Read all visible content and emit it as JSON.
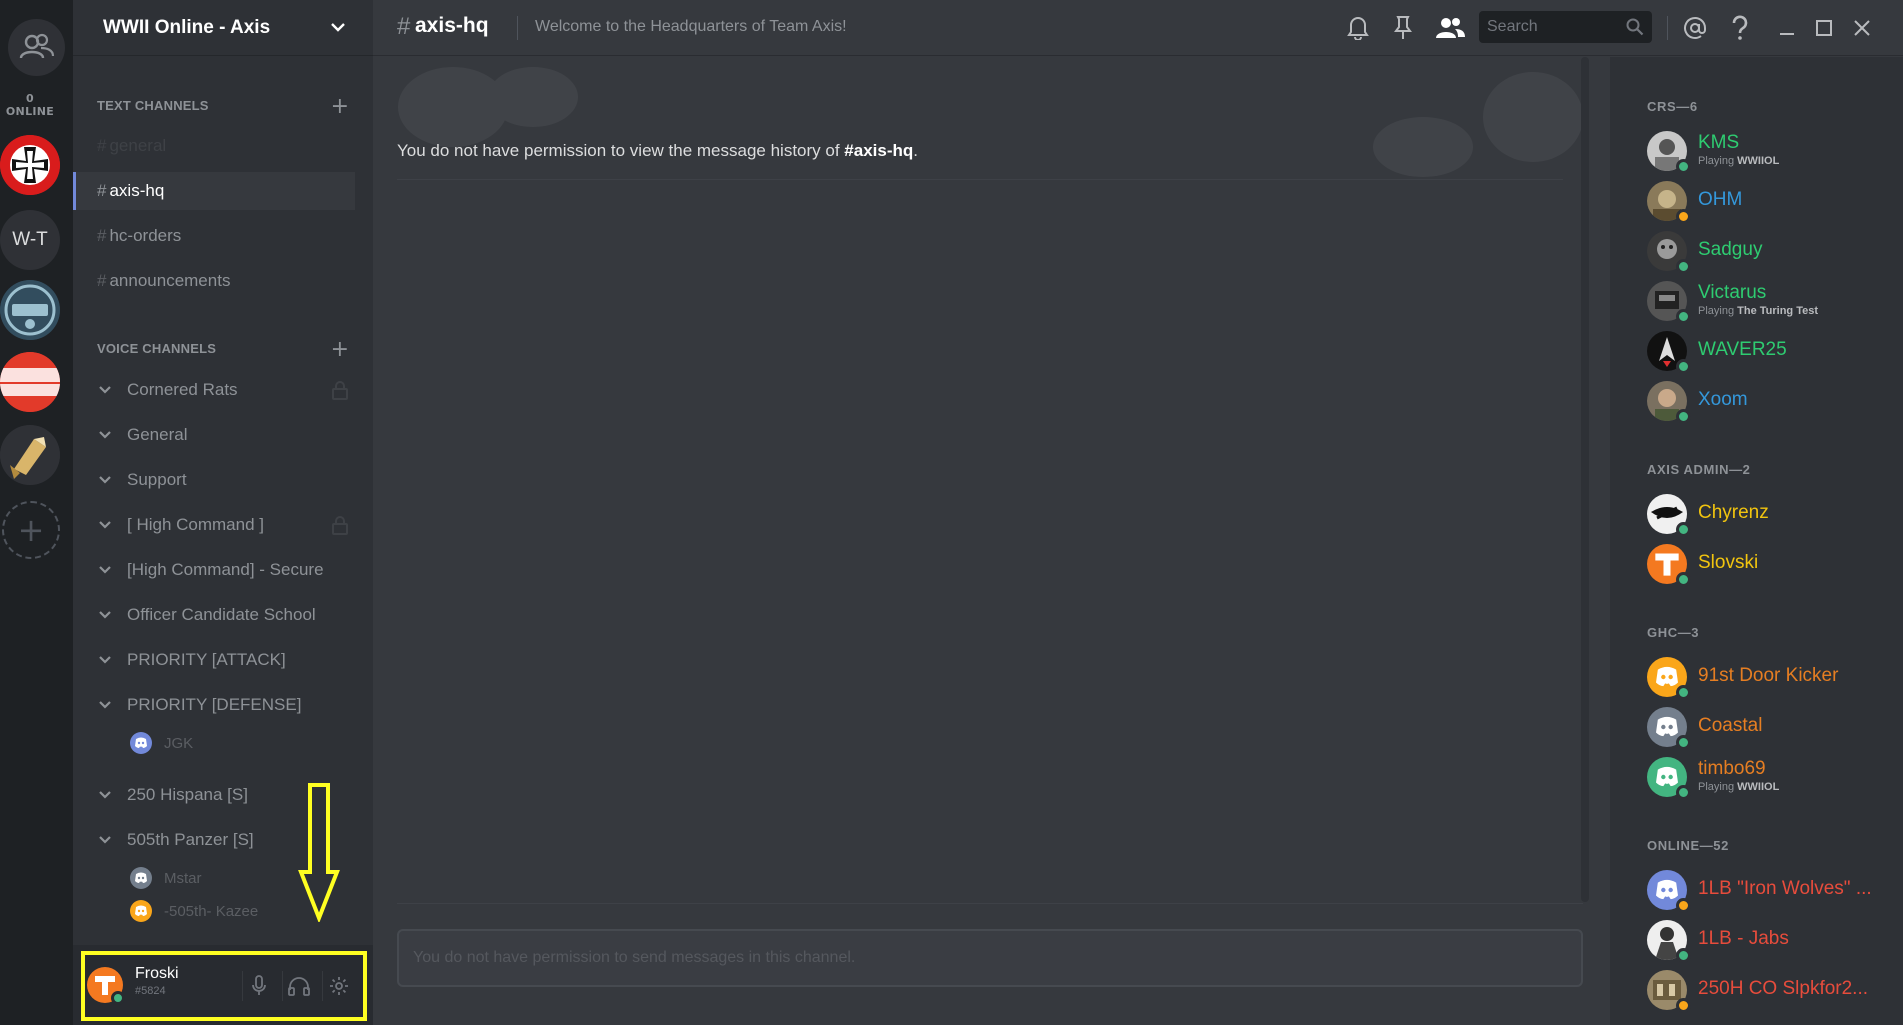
{
  "colors": {
    "accent": "#7289da",
    "online": "#43b581",
    "idle": "#faa61a",
    "highlight": "#ffff22",
    "role_crs": "#2ecc71",
    "role_blue": "#3498db",
    "role_admin": "#f1c40f",
    "role_ghc": "#e67e22",
    "role_online": "#e74c3c"
  },
  "guild_rail": {
    "online_count": "0 ONLINE",
    "guilds": [
      {
        "name": "iron-cross-server",
        "label": ""
      },
      {
        "name": "w-t-server",
        "label": "W-T"
      },
      {
        "name": "ard-server",
        "label": ""
      },
      {
        "name": "golden-corral-server",
        "label": ""
      },
      {
        "name": "rocket-server",
        "label": ""
      }
    ]
  },
  "server": {
    "name": "WWII Online - Axis"
  },
  "text_channels": {
    "header": "TEXT CHANNELS",
    "items": [
      {
        "name": "general"
      },
      {
        "name": "axis-hq"
      },
      {
        "name": "hc-orders"
      },
      {
        "name": "announcements"
      }
    ]
  },
  "voice_channels": {
    "header": "VOICE CHANNELS",
    "items": [
      {
        "name": "Cornered Rats"
      },
      {
        "name": "General"
      },
      {
        "name": "Support"
      },
      {
        "name": "[ High Command ]"
      },
      {
        "name": "[High Command] - Secure"
      },
      {
        "name": "Officer Candidate School"
      },
      {
        "name": "PRIORITY [ATTACK]"
      },
      {
        "name": "PRIORITY [DEFENSE]"
      },
      {
        "name": "250 Hispana [S]"
      },
      {
        "name": "505th Panzer [S]"
      }
    ],
    "users": [
      {
        "name": "JGK"
      },
      {
        "name": "Mstar"
      },
      {
        "name": "-505th- Kazee"
      }
    ]
  },
  "user": {
    "name": "Froski",
    "tag": "#5824"
  },
  "topbar": {
    "hash": "#",
    "channel": "axis-hq",
    "topic": "Welcome to the Headquarters of Team Axis!",
    "search_placeholder": "Search"
  },
  "messages": {
    "no_permission_prefix": "You do not have permission to view the message history of ",
    "no_permission_channel": "#axis-hq",
    "no_permission_suffix": ".",
    "composer_placeholder": "You do not have permission to send messages in this channel."
  },
  "members": {
    "groups": [
      {
        "label": "CRS—6"
      },
      {
        "label": "AXIS ADMIN—2"
      },
      {
        "label": "GHC—3"
      },
      {
        "label": "ONLINE—52"
      }
    ],
    "list": [
      {
        "name": "KMS",
        "playing_prefix": "Playing ",
        "game": "WWIIOL"
      },
      {
        "name": "OHM"
      },
      {
        "name": "Sadguy"
      },
      {
        "name": "Victarus",
        "playing_prefix": "Playing ",
        "game": "The Turing Test"
      },
      {
        "name": "WAVER25"
      },
      {
        "name": "Xoom"
      },
      {
        "name": "Chyrenz"
      },
      {
        "name": "Slovski"
      },
      {
        "name": "91st Door Kicker"
      },
      {
        "name": "Coastal"
      },
      {
        "name": "timbo69",
        "playing_prefix": "Playing ",
        "game": "WWIIOL"
      },
      {
        "name": "1LB \"Iron Wolves\" ..."
      },
      {
        "name": "1LB - Jabs"
      },
      {
        "name": "250H CO Slpkfor2..."
      }
    ]
  }
}
